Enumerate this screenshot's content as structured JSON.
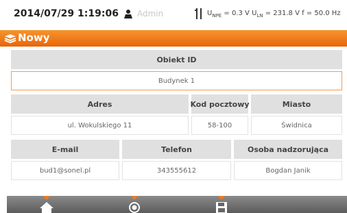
{
  "status": {
    "datetime": "2014/07/29 1:19:06",
    "user": "Admin",
    "measurements": {
      "unpe_label": "U",
      "unpe_sub": "NPE",
      "unpe_value": " = 0.3 V ",
      "uln_label": "U",
      "uln_sub": "LN",
      "uln_value": " = 231.8 V f = 50.0 Hz"
    }
  },
  "header": {
    "title": "Nowy"
  },
  "form": {
    "object_id": {
      "label": "Obiekt ID",
      "value": "Budynek 1"
    },
    "address": {
      "label": "Adres",
      "value": "ul. Wokulskiego 11"
    },
    "postal_code": {
      "label": "Kod pocztowy",
      "value": "58-100"
    },
    "city": {
      "label": "Miasto",
      "value": "Świdnica"
    },
    "email": {
      "label": "E-mail",
      "value": "bud1@sonel.pl"
    },
    "phone": {
      "label": "Telefon",
      "value": "343555612"
    },
    "supervisor": {
      "label": "Osoba nadzorująca",
      "value": "Bogdan Janik"
    }
  },
  "toolbar": {
    "items": [
      {
        "name": "home-icon"
      },
      {
        "name": "record-icon"
      },
      {
        "name": "save-icon"
      }
    ],
    "accent_color": "#f07a1e"
  },
  "colors": {
    "title_bar": "#f07a1e",
    "header_cell": "#e0e0e0",
    "active_border": "#f29a55"
  }
}
